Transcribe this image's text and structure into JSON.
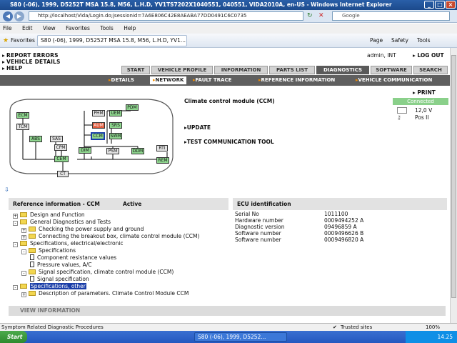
{
  "browser": {
    "title": "S80 (-06), 1999, D5252T MSA 15.8, M56, L.H.D, YV1TS7202X1040551, 040551, VIDA2010A, en-US - Windows Internet Explorer",
    "url": "http://localhost/Vida/Login.do;jsessionid=7A6E806C42E8AEABA77DD0491C6C0735",
    "search_placeholder": "Google",
    "menu": [
      "File",
      "Edit",
      "View",
      "Favorites",
      "Tools",
      "Help"
    ],
    "favorites_label": "Favorites",
    "tab_title": "S80 (-06), 1999, D5252T MSA 15.8, M56, L.H.D, YV1...",
    "toolbar": {
      "page": "Page",
      "safety": "Safety",
      "tools": "Tools"
    }
  },
  "header": {
    "links": [
      "REPORT ERRORS",
      "VEHICLE DETAILS",
      "HELP"
    ],
    "user": "admin, INT",
    "logout": "LOG OUT"
  },
  "tabs": [
    "START",
    "VEHICLE PROFILE",
    "INFORMATION",
    "PARTS LIST",
    "DIAGNOSTICS",
    "SOFTWARE",
    "SEARCH"
  ],
  "active_tab": "DIAGNOSTICS",
  "subtabs": [
    "DETAILS",
    "NETWORK",
    "FAULT TRACE",
    "REFERENCE INFORMATION",
    "VEHICLE COMMUNICATION"
  ],
  "active_subtab": "NETWORK",
  "print_label": "PRINT",
  "connection": {
    "status": "Connected",
    "voltage": "12,0 V",
    "key_position": "Pos II"
  },
  "network": {
    "ecus": {
      "ecm": "ECM",
      "tcm": "TCM",
      "abs": "ABS",
      "sas": "SAS",
      "cpm": "CPM",
      "cem": "CEM",
      "ct": "CT",
      "phm": "PHM",
      "uem": "UEM",
      "pdm": "PDM",
      "aum": "AUM",
      "srs": "SRS",
      "ccm": "CCM",
      "swm": "SWM",
      "dim": "DIM",
      "psm": "PSM",
      "ddm": "DDM",
      "rti": "RTI",
      "rem": "REM"
    },
    "selected": "CCM"
  },
  "module_title": "Climate control module (CCM)",
  "actions": {
    "update": "UPDATE",
    "test_comm": "TEST COMMUNICATION TOOL"
  },
  "reference": {
    "heading": "Reference information - CCM",
    "status": "Active",
    "tree": [
      "Design and Function",
      "General Diagnostics and Tests",
      "Checking the power supply and ground",
      "Connecting the breakout box, climate control module (CCM)",
      "Specifications, electrical/electronic",
      "Specifications",
      "Component resistance values",
      "Pressure values, A/C",
      "Signal specification, climate control module (CCM)",
      "Signal specification",
      "Specifications, other",
      "Description of parameters. Climate Control Module CCM"
    ]
  },
  "ecu_identification": {
    "heading": "ECU identification",
    "rows": [
      {
        "label": "Serial No",
        "value": "1011100"
      },
      {
        "label": "Hardware number",
        "value": "0009494252  A"
      },
      {
        "label": "Diagnostic version",
        "value": "09496859  A"
      },
      {
        "label": "Software number",
        "value": "0009496626  B"
      },
      {
        "label": "Software number",
        "value": "0009496820  A"
      }
    ]
  },
  "view_information": "VIEW INFORMATION",
  "statusbar": {
    "text": "Symptom Related Diagnostic Procedures",
    "zone": "Trusted sites",
    "zoom": "100%"
  },
  "taskbar": {
    "start": "Start",
    "item": "S80 (-06), 1999, D5252...",
    "clock": "14.25"
  }
}
